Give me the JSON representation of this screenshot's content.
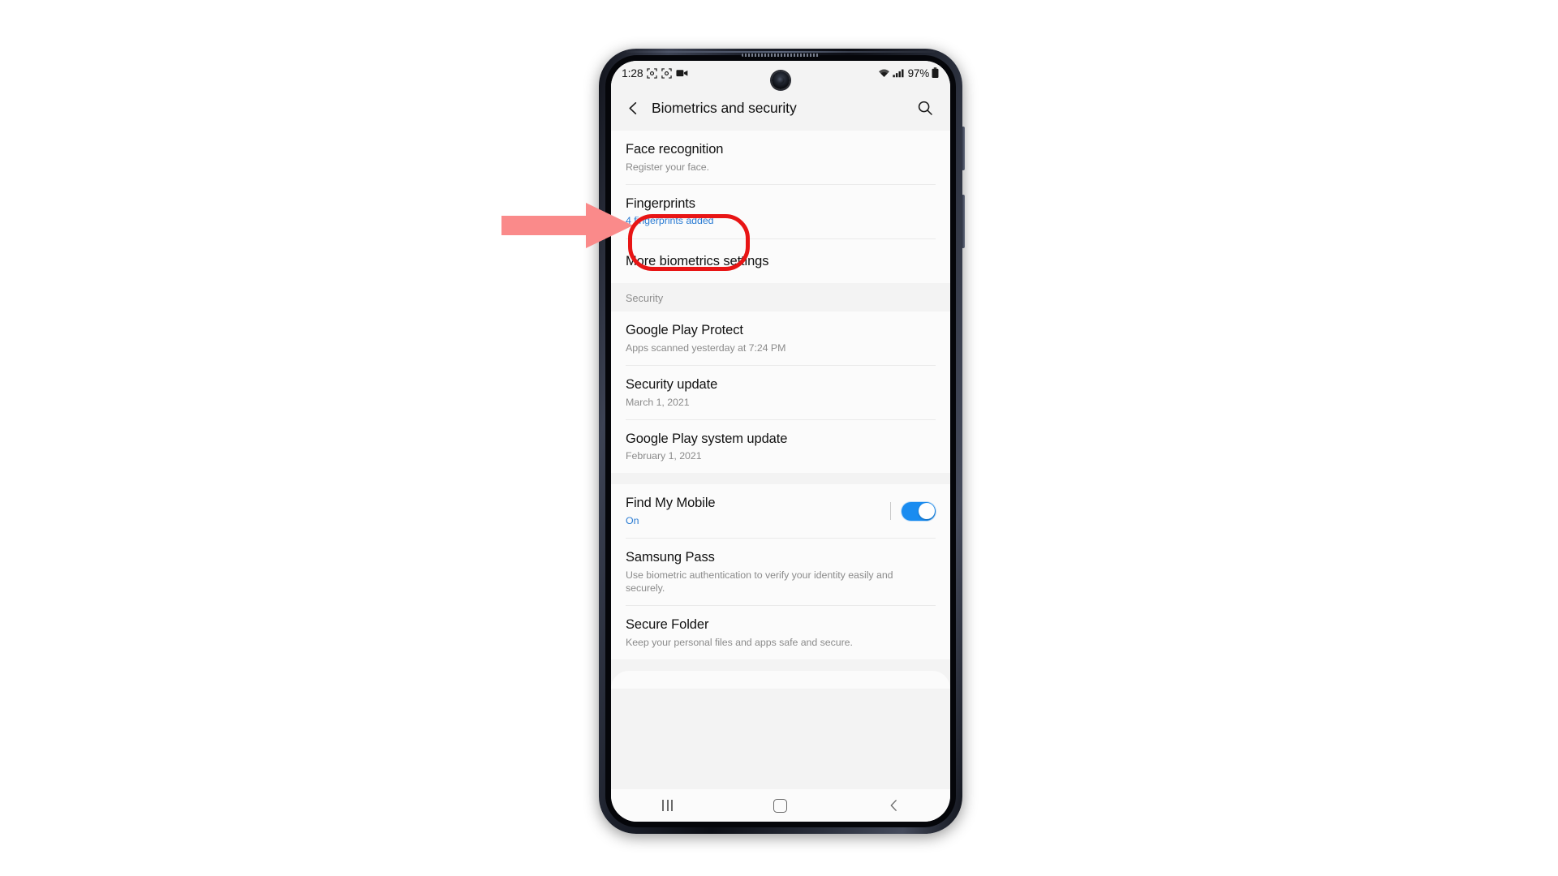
{
  "status_bar": {
    "clock": "1:28",
    "left_icons": [
      "screen-capture-icon",
      "screen-capture-icon",
      "video-recorder-icon"
    ],
    "right_icons": [
      "wifi-icon",
      "signal-icon"
    ],
    "battery_percent": "97%",
    "battery_icon": "battery-full-icon"
  },
  "app_bar": {
    "back_icon": "back-chevron-icon",
    "title": "Biometrics and security",
    "search_icon": "search-icon"
  },
  "biometrics_group": [
    {
      "title": "Face recognition",
      "subtitle": "Register your face.",
      "subtitle_accent": false,
      "name": "face-recognition"
    },
    {
      "title": "Fingerprints",
      "subtitle": "4 fingerprints added",
      "subtitle_accent": true,
      "name": "fingerprints"
    },
    {
      "title": "More biometrics settings",
      "subtitle": "",
      "subtitle_accent": false,
      "name": "more-biometrics-settings"
    }
  ],
  "security_section": {
    "header": "Security",
    "items": [
      {
        "title": "Google Play Protect",
        "subtitle": "Apps scanned yesterday at 7:24 PM",
        "name": "google-play-protect"
      },
      {
        "title": "Security update",
        "subtitle": "March 1, 2021",
        "name": "security-update"
      },
      {
        "title": "Google Play system update",
        "subtitle": "February 1, 2021",
        "name": "google-play-system-update"
      }
    ]
  },
  "services_group": [
    {
      "title": "Find My Mobile",
      "subtitle": "On",
      "subtitle_accent": true,
      "has_toggle": true,
      "toggle_state": "on",
      "name": "find-my-mobile"
    },
    {
      "title": "Samsung Pass",
      "subtitle": "Use biometric authentication to verify your identity easily and securely.",
      "subtitle_accent": false,
      "has_toggle": false,
      "name": "samsung-pass"
    },
    {
      "title": "Secure Folder",
      "subtitle": "Keep your personal files and apps safe and secure.",
      "subtitle_accent": false,
      "has_toggle": false,
      "name": "secure-folder"
    }
  ],
  "nav_bar": {
    "recents_label": "recents-icon",
    "home_label": "home-icon",
    "back_label": "back-icon"
  },
  "annotations": {
    "highlight_target": "Fingerprints",
    "ellipse_color": "#e81515",
    "arrow_color": "#fa8a8a"
  },
  "colors": {
    "accent_blue": "#2b7cd3",
    "toggle_on": "#1a8cf0",
    "screen_bg": "#f3f3f3",
    "card_bg": "#fbfbfb"
  }
}
